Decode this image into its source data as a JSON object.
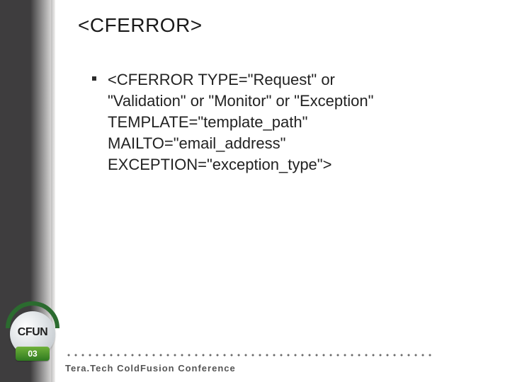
{
  "title": "<CFERROR>",
  "bullet": {
    "text": "<CFERROR TYPE=\"Request\" or\n\"Validation\" or \"Monitor\" or \"Exception\"\nTEMPLATE=\"template_path\"\nMAILTO=\"email_address\"\nEXCEPTION=\"exception_type\">"
  },
  "badge": {
    "label": "CFUN",
    "year": "03"
  },
  "footer": {
    "conference": "Tera.Tech ColdFusion Conference"
  }
}
